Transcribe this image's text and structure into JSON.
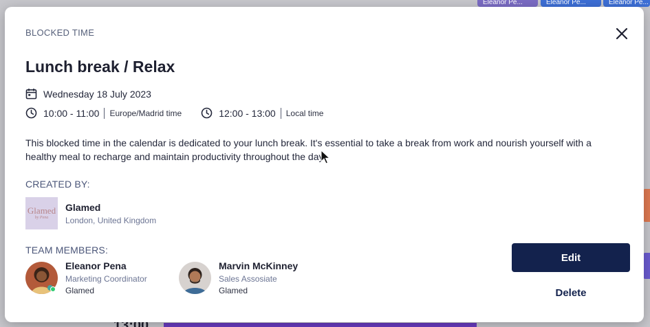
{
  "background": {
    "tabs": [
      "Eleanor Pe...",
      "Eleanor Pe...",
      "Eleanor Pe..."
    ],
    "bottom_time": "13:00"
  },
  "modal": {
    "eyebrow": "BLOCKED TIME",
    "title": "Lunch break / Relax",
    "date": "Wednesday 18 July 2023",
    "time_primary": "10:00 - 11:00",
    "time_primary_zone": "Europe/Madrid time",
    "time_local": "12:00 - 13:00",
    "time_local_zone": "Local time",
    "description": "This blocked time in the calendar is dedicated to your lunch break. It's essential to take a break from work and nourish yourself with a healthy meal to recharge and maintain productivity throughout the day.",
    "created_by_label": "CREATED BY:",
    "creator": {
      "name": "Glamed",
      "location": "London, United Kingdom",
      "logo_text": "Glamed",
      "logo_sub": "by Pena"
    },
    "team_label": "TEAM MEMBERS:",
    "members": [
      {
        "name": "Eleanor Pena",
        "role": "Marketing Coordinator",
        "org": "Glamed",
        "online": true
      },
      {
        "name": "Marvin McKinney",
        "role": "Sales Assosiate",
        "org": "Glamed",
        "online": false
      }
    ],
    "edit_label": "Edit",
    "delete_label": "Delete"
  },
  "icons": {
    "close": "close-icon",
    "calendar": "calendar-icon",
    "clock": "clock-icon"
  },
  "colors": {
    "primary": "#13224d",
    "label": "#4a5578",
    "online": "#2ecc71"
  }
}
